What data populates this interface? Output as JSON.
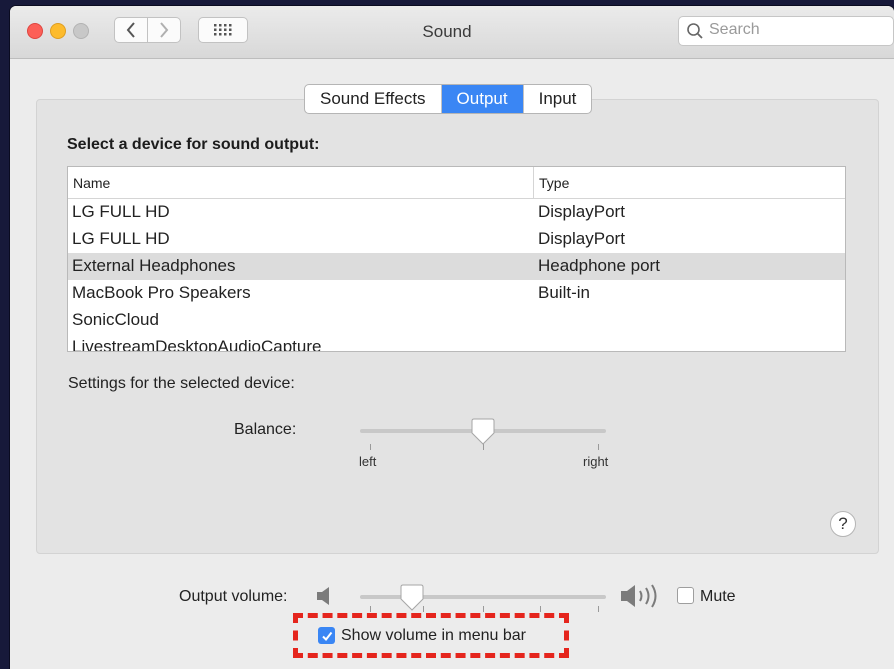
{
  "window": {
    "title": "Sound"
  },
  "search": {
    "placeholder": "Search"
  },
  "tabs": [
    {
      "label": "Sound Effects"
    },
    {
      "label": "Output"
    },
    {
      "label": "Input"
    }
  ],
  "active_tab": "Output",
  "section_title": "Select a device for sound output:",
  "table": {
    "columns": [
      "Name",
      "Type"
    ],
    "rows": [
      {
        "name": "LG FULL HD",
        "type": "DisplayPort"
      },
      {
        "name": "LG FULL HD",
        "type": "DisplayPort"
      },
      {
        "name": "External Headphones",
        "type": "Headphone port"
      },
      {
        "name": "MacBook Pro Speakers",
        "type": "Built-in"
      },
      {
        "name": "SonicCloud",
        "type": ""
      },
      {
        "name": "LivestreamDesktopAudioCapture",
        "type": ""
      }
    ],
    "selected_row": 2
  },
  "settings_label": "Settings for the selected device:",
  "balance": {
    "label": "Balance:",
    "left_label": "left",
    "right_label": "right",
    "value": 0.5
  },
  "help_label": "?",
  "output_volume": {
    "label": "Output volume:",
    "value": 0.21
  },
  "mute": {
    "label": "Mute",
    "checked": false
  },
  "show_volume": {
    "label": "Show volume in menu bar",
    "checked": true
  },
  "colors": {
    "accent": "#3a86f4",
    "highlight": "#e5251d",
    "close": "#fc5f57",
    "minimize": "#fdbb2d"
  },
  "icons": [
    "chevron-left-icon",
    "chevron-right-icon",
    "grid-icon",
    "search-icon",
    "speaker-low-icon",
    "speaker-high-icon",
    "checkmark-icon",
    "help-icon"
  ]
}
